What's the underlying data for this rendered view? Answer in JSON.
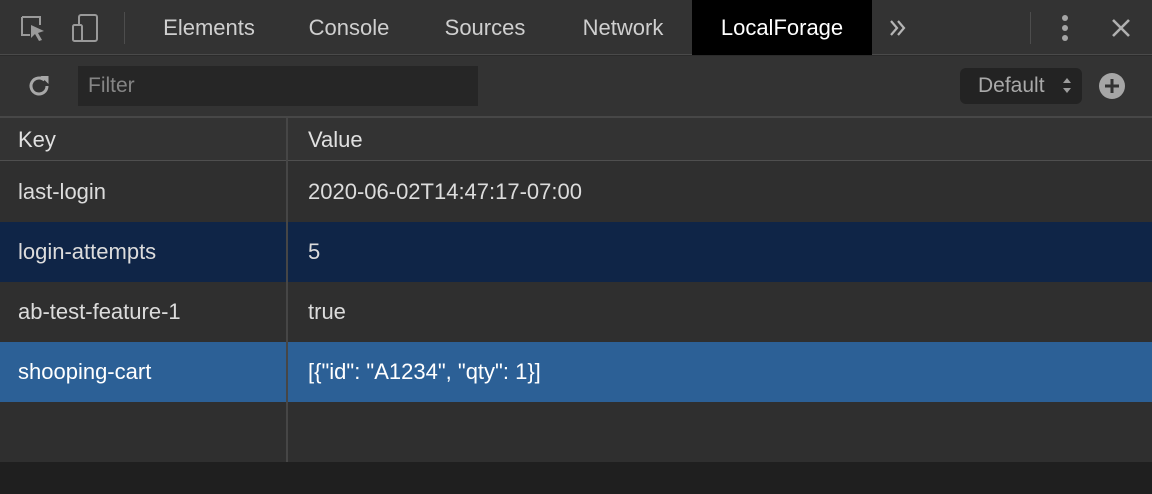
{
  "tabs": [
    {
      "label": "Elements",
      "active": false
    },
    {
      "label": "Console",
      "active": false
    },
    {
      "label": "Sources",
      "active": false
    },
    {
      "label": "Network",
      "active": false
    },
    {
      "label": "LocalForage",
      "active": true
    }
  ],
  "toolbar": {
    "filter_placeholder": "Filter",
    "filter_value": "",
    "store_select": "Default"
  },
  "table": {
    "headers": {
      "key": "Key",
      "value": "Value"
    },
    "rows": [
      {
        "key": "last-login",
        "value": "2020-06-02T14:47:17-07:00",
        "state": "normal"
      },
      {
        "key": "login-attempts",
        "value": "5",
        "state": "selected-inactive"
      },
      {
        "key": "ab-test-feature-1",
        "value": "true",
        "state": "normal"
      },
      {
        "key": "shooping-cart",
        "value": "[{\"id\": \"A1234\", \"qty\": 1}]",
        "state": "selected-active"
      }
    ]
  },
  "icons": {
    "inspect": "inspect-element-icon",
    "device": "device-toolbar-icon",
    "more_tabs": "chevron-double-right-icon",
    "menu": "kebab-menu-icon",
    "close": "close-icon",
    "refresh": "refresh-icon",
    "add": "add-circle-icon"
  },
  "colors": {
    "active_tab_bg": "#000000",
    "row_selected_active": "#2c6096",
    "row_selected_inactive": "#0f2547"
  }
}
